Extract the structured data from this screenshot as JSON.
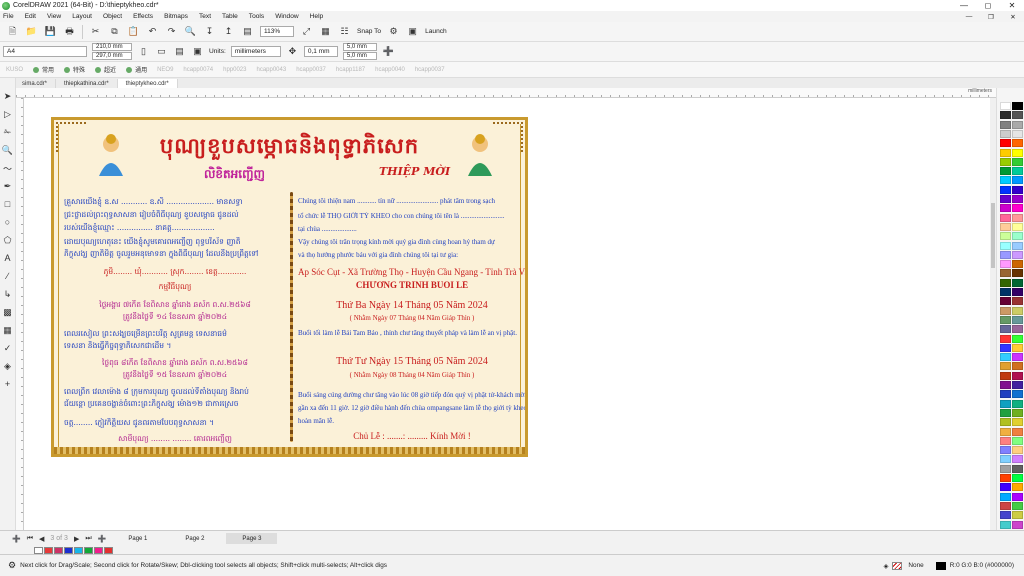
{
  "window": {
    "title": "CorelDRAW 2021 (64-Bit) - D:\\thieptykheo.cdr*"
  },
  "menu": [
    "File",
    "Edit",
    "View",
    "Layout",
    "Object",
    "Effects",
    "Bitmaps",
    "Text",
    "Table",
    "Tools",
    "Window",
    "Help"
  ],
  "standard_toolbar": {
    "zoom": "113%",
    "snap": "Snap To",
    "launch": "Launch"
  },
  "property_bar": {
    "page_size": "A4",
    "width": "210,0 mm",
    "height": "297,0 mm",
    "units_label": "Units:",
    "units": "millimeters",
    "nudge": "0,1 mm",
    "dup_x": "5,0 mm",
    "dup_y": "5,0 mm"
  },
  "app_bar": [
    "KUSO",
    "常用",
    "特殊",
    "超近",
    "通用",
    "NEO9",
    "hcapp0074",
    "hpp0023",
    "hcapp0043",
    "hcapp0037",
    "hcapp1187",
    "hcapp0040",
    "hcapp0037"
  ],
  "doc_tabs": [
    {
      "label": "sima.cdr*"
    },
    {
      "label": "thiepkathina.cdr*"
    },
    {
      "label": "thieptykheo.cdr*"
    }
  ],
  "ruler_units": "millimeters",
  "page_nav": {
    "counter": "3 of 3",
    "pages": [
      "Page 1",
      "Page 2",
      "Page 3"
    ]
  },
  "status": {
    "hint": "Next click for Drag/Scale; Second click for Rotate/Skew; Dbl-clicking tool selects all objects; Shift+click multi-selects; Alt+click digs",
    "fill": "None",
    "stroke": "R:0 G:0 B:0 (#000000)"
  },
  "document": {
    "kh_title": "បុណ្យខួបសម្ភោធនិងពុទ្ធាភិសេក",
    "kh_sub": "លិខិតអញ្ជើញ",
    "thiep": "THIỆP MỜI",
    "kh_lines": [
      {
        "t": "គ្រួសារយើងខ្ញុំ ឧ.ស ........... ឧ.សិ .................... មានសទ្ធា",
        "c": ""
      },
      {
        "t": "ជ្រះថ្លាដល់ព្រះពុទ្ធសាសនា រៀបចំពិធីបុណ្យ ខួបសម្ភោធ ជូនដល់",
        "c": ""
      },
      {
        "t": "របស់យើងខ្ញុំឈ្មោះ ............... នាគត្ត..................",
        "c": ""
      },
      {
        "t": "ដោយបុណ្យហេតុនេះ យើងខ្ញុំសូមគោរពអញ្ជើញ ពុទ្ធបរិស័ទ ញាតិ",
        "c": ""
      },
      {
        "t": "ភិក្ខុសង្ឃ ញាតិមិត្ត ចូលរួមអនុមោទនា ក្នុងពិធីបុណ្យ ដែលនឹងប្រព្រឹត្តទៅ",
        "c": ""
      },
      {
        "t": "ភូមិ........ ឃុំ........... ស្រុក........ ខេត្ត............",
        "c": "red"
      },
      {
        "t": "កម្មវិធីបុណ្យ",
        "c": "red"
      },
      {
        "t": "ថ្ងៃអង្គារ ៧កើត ខែពិសាខ ឆ្នាំរោង ឆស័ក ព.ស.២៥៦៨",
        "c": "mag"
      },
      {
        "t": "ត្រូវនឹងថ្ងៃទី ១៤ ខែឧសភា ឆ្នាំ២០២៤",
        "c": "mag"
      },
      {
        "t": "ពេលរសៀល ព្រះសង្ឃចម្រើនព្រះបរិត្ត សូត្រមន្ត ទេសនាធម៌",
        "c": ""
      },
      {
        "t": "ទេសនា និងធ្វើកិច្ចពុទ្ធាភិសេកជាដើម ។",
        "c": ""
      },
      {
        "t": "ថ្ងៃពុធ ៨កើត ខែពិសាខ ឆ្នាំរោង ឆស័ក ព.ស.២៥៦៨",
        "c": "mag"
      },
      {
        "t": "ត្រូវនឹងថ្ងៃទី ១៥ ខែឧសភា ឆ្នាំ២០២៤",
        "c": "mag"
      },
      {
        "t": "ពេលព្រឹក វេលាម៉ោង ៨ ក្រុមការបុណ្យ ចូលដល់ទីតាំងបុណ្យ និងរាប់",
        "c": ""
      },
      {
        "t": "ជ័យន្តោ ប្រគេនចង្ហាន់ចំពោះព្រះភិក្ខុសង្ឃ ម៉ោង១២ ជាការស្រេច",
        "c": ""
      },
      {
        "t": "ចត្ត........ ភ្ញៀវកិត្តិយស ជូនពរតាមបែបពុទ្ធសាសនា ។",
        "c": ""
      },
      {
        "t": "សាមីបុណ្យ ........ ........ គោរពអញ្ជើញ",
        "c": "mag"
      }
    ],
    "vn_lines": [
      {
        "t": "Chúng tôi thiện nam ........... tín nữ ........................ phát tâm trong sạch",
        "c": ""
      },
      {
        "t": "tổ chức lễ THỌ GIỚI TỲ KHEO cho con chúng tôi tên là .........................",
        "c": ""
      },
      {
        "t": "tại chùa ....................",
        "c": ""
      },
      {
        "t": "Vậy chúng tôi trân trọng kính mời quý gia đình cùng hoan hỷ tham dự",
        "c": ""
      },
      {
        "t": "và thọ hưởng phước báu với gia đình chúng tôi tại tư gia:",
        "c": ""
      },
      {
        "t": "Ấp Sóc Cụt - Xã Trường Thọ - Huyện Cầu Ngang - Tỉnh Trà Vinh",
        "c": "big"
      },
      {
        "t": "CHƯƠNG TRÌNH BUỔI LỄ",
        "c": "prog"
      },
      {
        "t": "Thứ Ba Ngày 14 Tháng 05 Năm 2024",
        "c": "ddate"
      },
      {
        "t": "( Nhằm Ngày 07 Tháng 04 Năm Giáp Thìn )",
        "c": "ddd"
      },
      {
        "t": "Buổi tối làm lễ Bái Tam Bảo , thỉnh chư tăng thuyết pháp và làm lễ an vị phật.",
        "c": ""
      },
      {
        "t": "Thứ Tư Ngày 15 Tháng 05 Năm 2024",
        "c": "ddate"
      },
      {
        "t": "( Nhằm Ngày 08 Tháng 04 Năm Giáp Thìn )",
        "c": "ddd"
      },
      {
        "t": "Buổi sáng cúng dường chư tăng vào lúc 08 giờ tiếp đón quý vị phật tử-khách mời",
        "c": ""
      },
      {
        "t": "gần xa đến 11 giờ. 12 giờ điều hành đến chùa ompangsane làm lễ thọ giới tỳ kheo.",
        "c": ""
      },
      {
        "t": "hoàn mãn lễ.",
        "c": ""
      },
      {
        "t": "Chủ Lễ : .......: ......... Kính Mời !",
        "c": "sign"
      }
    ]
  },
  "colors": {
    "accent_red": "#c81e1e",
    "kh_blue": "#2040c0",
    "magenta": "#b0208e",
    "border_gold": "#c99a2e"
  }
}
